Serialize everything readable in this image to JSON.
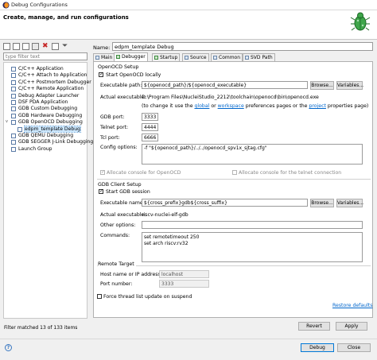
{
  "window": {
    "title": "Debug Configurations"
  },
  "banner": {
    "title": "Create, manage, and run configurations"
  },
  "left": {
    "filter_placeholder": "type filter text",
    "tree": [
      {
        "label": "C/C++ Application",
        "indent": 1
      },
      {
        "label": "C/C++ Attach to Application",
        "indent": 1
      },
      {
        "label": "C/C++ Postmortem Debugger",
        "indent": 1
      },
      {
        "label": "C/C++ Remote Application",
        "indent": 1
      },
      {
        "label": "Debug Adapter Launcher",
        "indent": 1
      },
      {
        "label": "DSF PDA Application",
        "indent": 1
      },
      {
        "label": "GDB Custom Debugging",
        "indent": 1
      },
      {
        "label": "GDB Hardware Debugging",
        "indent": 1
      },
      {
        "label": "GDB OpenOCD Debugging",
        "indent": 1,
        "expanded": true
      },
      {
        "label": "edpm_template Debug",
        "indent": 2,
        "selected": true
      },
      {
        "label": "GDB QEMU Debugging",
        "indent": 1
      },
      {
        "label": "GDB SEGGER J-Link Debugging",
        "indent": 1
      },
      {
        "label": "Launch Group",
        "indent": 1
      }
    ],
    "expand_glyph": "v",
    "status": "Filter matched 13 of 133 items"
  },
  "config": {
    "name_label": "Name:",
    "name_value": "edpm_template Debug",
    "tabs": [
      {
        "label": "Main"
      },
      {
        "label": "Debugger",
        "active": true
      },
      {
        "label": "Startup"
      },
      {
        "label": "Source"
      },
      {
        "label": "Common"
      },
      {
        "label": "SVD Path"
      }
    ]
  },
  "openocd": {
    "group_label": "OpenOCD Setup",
    "start_locally_label": "Start OpenOCD locally",
    "exe_path_label": "Executable path:",
    "exe_path_value": "${openocd_path}/${openocd_executable}",
    "browse_label": "Browse...",
    "variables_label": "Variables...",
    "actual_exe_label": "Actual executable:",
    "actual_exe_value": "D:\\Program Files\\NucleiStudio_2212\\toolchain\\openocd\\bin\\openocd.exe",
    "change_pre": "(to change it use the ",
    "global_link": "global",
    "or_text": " or ",
    "workspace_link": "workspace",
    "change_mid": " preferences pages or the ",
    "project_link": "project",
    "change_post": " properties page)",
    "gdb_port_label": "GDB port:",
    "gdb_port_value": "3333",
    "telnet_port_label": "Telnet port:",
    "telnet_port_value": "4444",
    "tcl_port_label": "Tcl port:",
    "tcl_port_value": "6666",
    "config_options_label": "Config options:",
    "config_options_value": "-f \"${openocd_path}/../../openocd_spv1x_sjtag.cfg\"",
    "alloc_console_label": "Allocate console for OpenOCD",
    "alloc_telnet_label": "Allocate console for the telnet connection"
  },
  "gdbclient": {
    "group_label": "GDB Client Setup",
    "start_gdb_label": "Start GDB session",
    "exe_name_label": "Executable name:",
    "exe_name_value": "${cross_prefix}gdb${cross_suffix}",
    "browse_label": "Browse...",
    "variables_label": "Variables...",
    "actual_exe_label": "Actual executable:",
    "actual_exe_value": "riscv-nuclei-elf-gdb",
    "other_options_label": "Other options:",
    "other_options_value": "",
    "commands_label": "Commands:",
    "commands_lines": [
      "set  remotetimeout 250",
      "set arch riscv:rv32"
    ]
  },
  "remote": {
    "group_label": "Remote Target",
    "host_label": "Host name or IP address:",
    "host_value": "localhost",
    "port_label": "Port number:",
    "port_value": "3333"
  },
  "force_thread_label": "Force thread list update on suspend",
  "restore_defaults_label": "Restore defaults",
  "buttons": {
    "revert": "Revert",
    "apply": "Apply",
    "debug": "Debug",
    "close": "Close"
  }
}
